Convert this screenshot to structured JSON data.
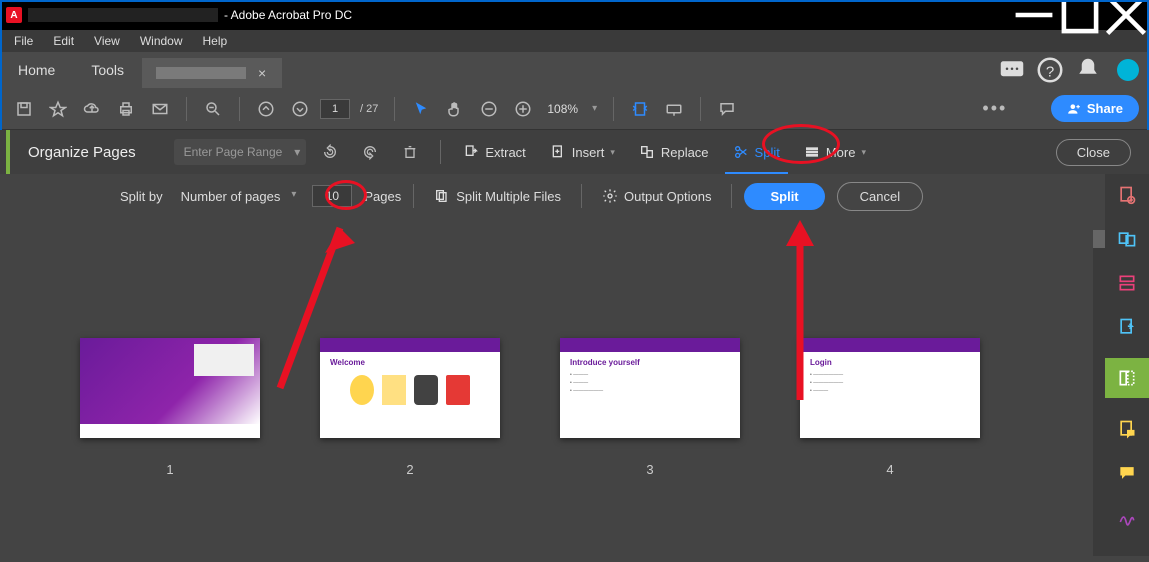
{
  "title_suffix": " - Adobe Acrobat Pro DC",
  "menus": {
    "file": "File",
    "edit": "Edit",
    "view": "View",
    "window": "Window",
    "help": "Help"
  },
  "tabs": {
    "home": "Home",
    "tools": "Tools"
  },
  "toolbar": {
    "page_current": "1",
    "page_total": "/ 27",
    "zoom": "108%",
    "share": "Share"
  },
  "organize": {
    "title": "Organize Pages",
    "range_placeholder": "Enter Page Range",
    "extract": "Extract",
    "insert": "Insert",
    "replace": "Replace",
    "split": "Split",
    "more": "More",
    "close": "Close"
  },
  "split": {
    "split_by_label": "Split by",
    "method": "Number of pages",
    "count": "10",
    "pages_label": "Pages",
    "multi": "Split Multiple Files",
    "output": "Output Options",
    "split_btn": "Split",
    "cancel": "Cancel"
  },
  "thumbs": [
    {
      "num": "1",
      "title": ""
    },
    {
      "num": "2",
      "title": "Welcome"
    },
    {
      "num": "3",
      "title": "Introduce yourself"
    },
    {
      "num": "4",
      "title": "Login"
    }
  ],
  "colors": {
    "accent": "#2e8bff",
    "annot": "#e81123",
    "green": "#7cb342"
  }
}
